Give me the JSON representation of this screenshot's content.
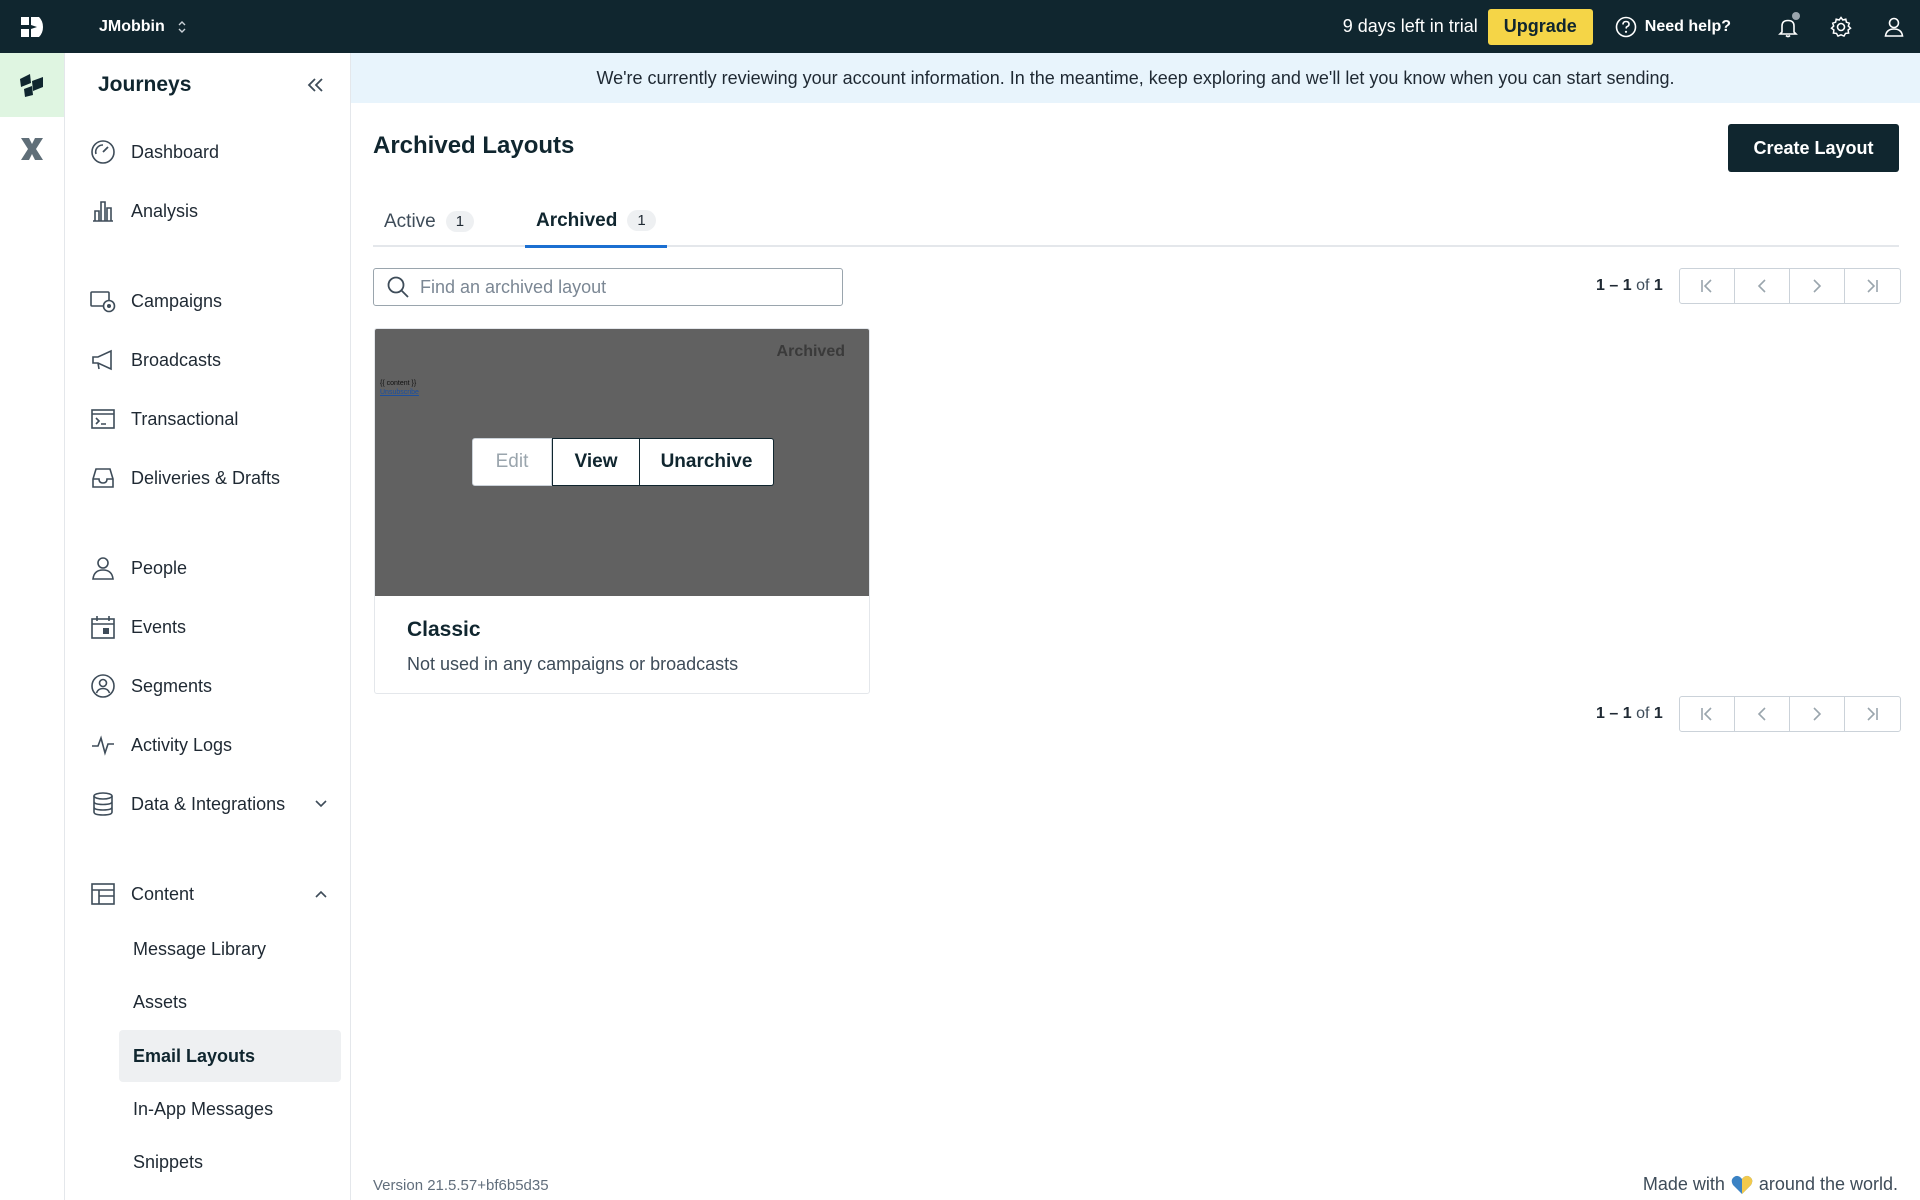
{
  "topbar": {
    "workspace": "JMobbin",
    "trial_text": "9 days left in trial",
    "upgrade_label": "Upgrade",
    "help_label": "Need help?"
  },
  "sidebar": {
    "title": "Journeys",
    "groups": [
      [
        "Dashboard",
        "Analysis"
      ],
      [
        "Campaigns",
        "Broadcasts",
        "Transactional",
        "Deliveries & Drafts"
      ],
      [
        "People",
        "Events",
        "Segments",
        "Activity Logs",
        "Data & Integrations"
      ],
      [
        "Content"
      ]
    ],
    "items": {
      "dashboard": "Dashboard",
      "analysis": "Analysis",
      "campaigns": "Campaigns",
      "broadcasts": "Broadcasts",
      "transactional": "Transactional",
      "deliveries": "Deliveries & Drafts",
      "people": "People",
      "events": "Events",
      "segments": "Segments",
      "activity_logs": "Activity Logs",
      "data_integrations": "Data & Integrations",
      "content": "Content"
    },
    "content_sub": {
      "message_library": "Message Library",
      "assets": "Assets",
      "email_layouts": "Email Layouts",
      "in_app": "In-App Messages",
      "snippets": "Snippets"
    }
  },
  "banner": "We're currently reviewing your account information. In the meantime, keep exploring and we'll let you know when you can start sending.",
  "page": {
    "title": "Archived Layouts",
    "create_label": "Create Layout",
    "tabs": [
      {
        "label": "Active",
        "count": "1"
      },
      {
        "label": "Archived",
        "count": "1"
      }
    ],
    "search_placeholder": "Find an archived layout",
    "pager": {
      "start": "1",
      "sep": "–",
      "end": "1",
      "of": "of",
      "total": "1"
    }
  },
  "card": {
    "tag": "Archived",
    "mini_line1": "{{ content }}",
    "mini_line2": "Unsubscribe",
    "edit_label": "Edit",
    "view_label": "View",
    "unarchive_label": "Unarchive",
    "name": "Classic",
    "description": "Not used in any campaigns or broadcasts"
  },
  "footer": {
    "version": "Version 21.5.57+bf6b5d35",
    "made_prefix": "Made with",
    "made_suffix": "around the world."
  },
  "colors": {
    "topbar": "#10262f",
    "upgrade": "#f5d547",
    "accent_tab": "#1b6fd1",
    "banner": "#e8f4fc",
    "rail_active": "#dff5e1"
  }
}
